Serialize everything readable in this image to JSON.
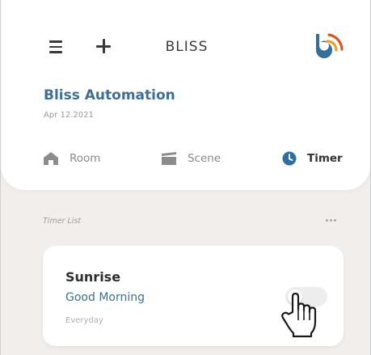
{
  "header": {
    "title": "BLISS",
    "menu_icon": "hamburger-menu-icon",
    "add_icon": "plus-icon",
    "logo_icon": "bliss-logo-icon",
    "brand_color": "#3f6f93",
    "logo_colors": [
      "#2f6f9f",
      "#f0a01c",
      "#e0531f"
    ]
  },
  "home": {
    "name": "Bliss Automation",
    "date": "Apr 12.2021"
  },
  "tabs": [
    {
      "label": "Room",
      "icon": "house-icon",
      "active": false
    },
    {
      "label": "Scene",
      "icon": "scene-icon",
      "active": false
    },
    {
      "label": "Timer",
      "icon": "clock-icon",
      "active": true
    }
  ],
  "timer_list": {
    "label": "Timer List",
    "more_icon": "more-options-icon",
    "items": [
      {
        "name": "Sunrise",
        "subtitle": "Good Morning",
        "repeat": "Everyday",
        "enabled": false
      }
    ]
  },
  "cursor": "hand-pointer-icon"
}
